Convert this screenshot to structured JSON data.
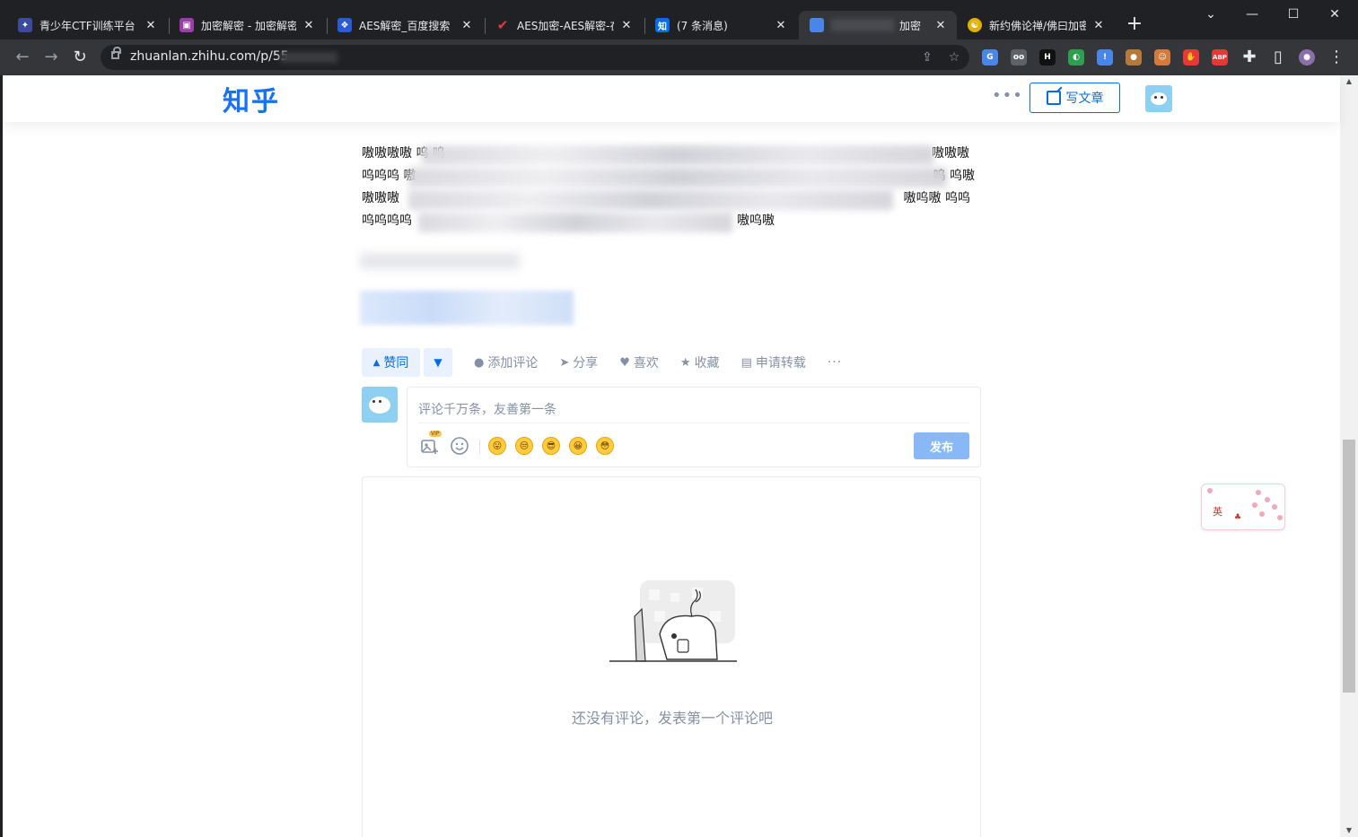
{
  "browser": {
    "tabs": [
      {
        "title": "青少年CTF训练平台 |",
        "icon_color": "#3b4a9c",
        "icon": "ctf-icon"
      },
      {
        "title": "加密解密 - 加密解密",
        "icon_color": "#9b3fa8",
        "icon": "lock-app-icon"
      },
      {
        "title": "AES解密_百度搜索",
        "icon_color": "#2d5bd8",
        "icon": "baidu-paw-icon"
      },
      {
        "title": "AES加密-AES解密-在",
        "icon_color": "#e23b3b",
        "icon": "checkmark-icon"
      },
      {
        "title": "(7 条消息)",
        "icon_color": "#056de8",
        "icon": "zhihu-icon",
        "icon_text": "知"
      },
      {
        "title": "加密（",
        "icon_color": "#4a86e8",
        "icon": "article-icon",
        "active": true
      },
      {
        "title": "新约佛论禅/佛曰加密",
        "icon_color": "#e2b100",
        "icon": "buddha-icon"
      }
    ],
    "new_tab": "+",
    "url": "zhuanlan.zhihu.com/p/55",
    "extensions": [
      {
        "name": "translate-extension-icon",
        "color": "#4a86e8",
        "text": "G"
      },
      {
        "name": "glasses-extension-icon",
        "color": "#5f6368",
        "text": "oo"
      },
      {
        "name": "dark-extension-icon",
        "color": "#111111",
        "text": "H"
      },
      {
        "name": "green-extension-icon",
        "color": "#2e9e4f",
        "text": "◐"
      },
      {
        "name": "alert-extension-icon",
        "color": "#4a86e8",
        "text": "!"
      },
      {
        "name": "cookie-extension-icon",
        "color": "#b5793a",
        "text": "●"
      },
      {
        "name": "monkey-extension-icon",
        "color": "#d47a3a",
        "text": "☺"
      },
      {
        "name": "red-extension-icon",
        "color": "#e53935",
        "text": "✋"
      },
      {
        "name": "abp-extension-icon",
        "color": "#e53935",
        "text": "ABP"
      }
    ]
  },
  "page": {
    "logo": "知乎",
    "write_article": "写文章",
    "article_lines": [
      "嗷嗷嗷嗷 呜 呜",
      "呜呜呜 嗷",
      "嗷嗷嗷",
      "呜呜呜呜"
    ],
    "article_line_ends": [
      "嗷嗷嗷",
      "呜 呜嗷",
      "嗷呜嗷 呜呜",
      "嗷呜嗷"
    ],
    "actions": {
      "upvote": "赞同",
      "comment": "添加评论",
      "share": "分享",
      "like": "喜欢",
      "collect": "收藏",
      "repost": "申请转载"
    },
    "comment": {
      "placeholder": "评论千万条，友善第一条",
      "publish": "发布",
      "vip_badge": "VIP",
      "emojis": [
        "😛",
        "😒",
        "😎",
        "😀",
        "😳"
      ]
    },
    "empty_comments": "还没有评论，发表第一个评论吧",
    "floating_widget": "英"
  }
}
